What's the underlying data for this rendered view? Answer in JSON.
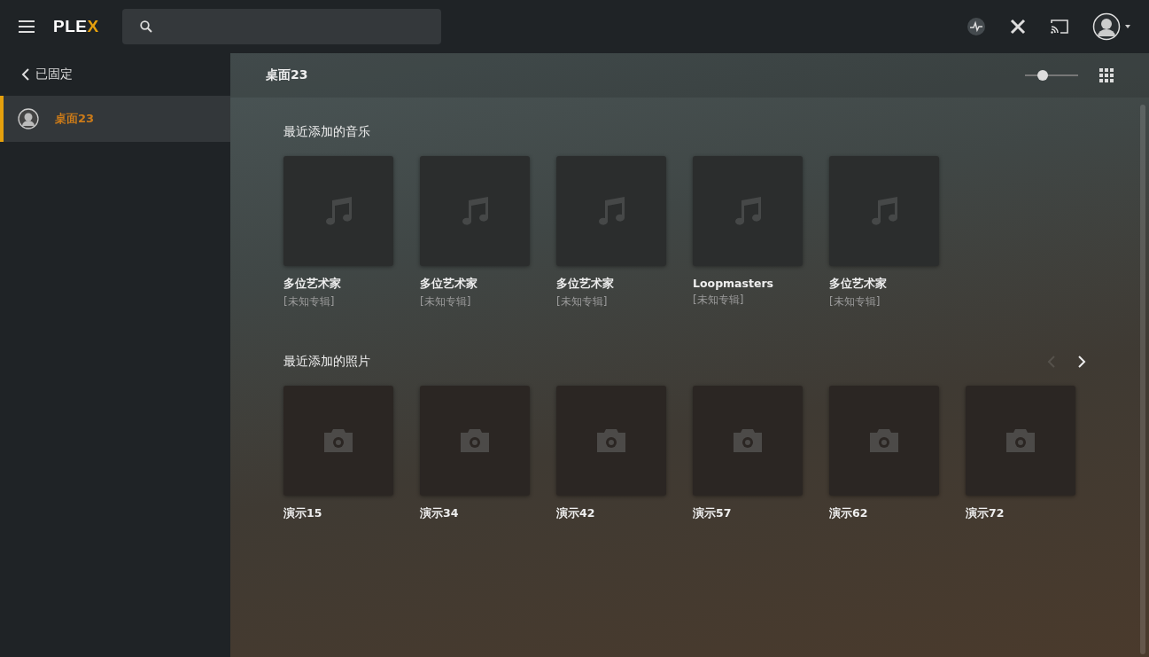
{
  "topbar": {
    "logo": "PLEX"
  },
  "sidebar": {
    "back": "已固定",
    "items": [
      {
        "label": "桌面23",
        "selected": true
      }
    ]
  },
  "header": {
    "title": "桌面23",
    "size_slider": {
      "level": 0.33
    }
  },
  "sections": [
    {
      "title": "最近添加的音乐",
      "kind": "music",
      "items": [
        {
          "title": "多位艺术家",
          "subtitle": "[未知专辑]"
        },
        {
          "title": "多位艺术家",
          "subtitle": "[未知专辑]"
        },
        {
          "title": "多位艺术家",
          "subtitle": "[未知专辑]"
        },
        {
          "title": "Loopmasters",
          "subtitle": "[未知专辑]"
        },
        {
          "title": "多位艺术家",
          "subtitle": "[未知专辑]"
        }
      ]
    },
    {
      "title": "最近添加的照片",
      "kind": "photo",
      "prev_enabled": false,
      "next_enabled": true,
      "items": [
        {
          "title": "演示15"
        },
        {
          "title": "演示34"
        },
        {
          "title": "演示42"
        },
        {
          "title": "演示57"
        },
        {
          "title": "演示62"
        },
        {
          "title": "演示72"
        }
      ]
    }
  ]
}
